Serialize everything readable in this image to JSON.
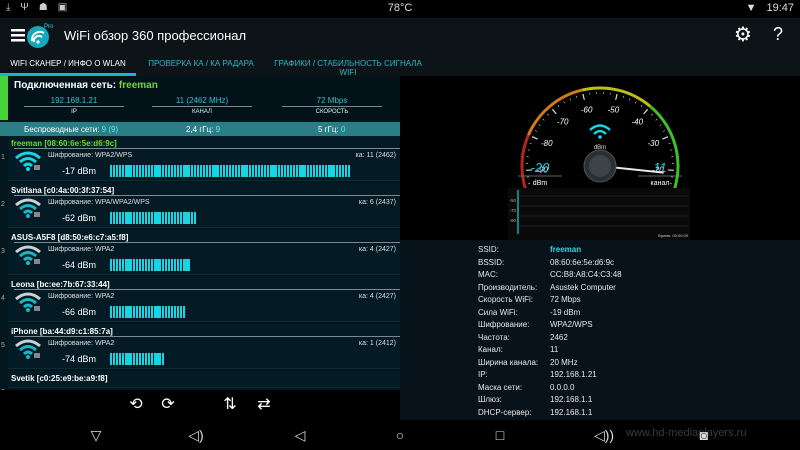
{
  "status_bar": {
    "left_icons": [
      "download-icon",
      "usb-icon",
      "android-icon",
      "image-icon"
    ],
    "temperature": "78°C",
    "time": "19:47"
  },
  "app_bar": {
    "logo_badge": "Pro",
    "title": "WiFi обзор 360 профессионал",
    "settings_icon": "gear-icon",
    "help_label": "?"
  },
  "tabs": [
    {
      "label": "WIFI СКАНЕР / ИНФО О WLAN",
      "active": true
    },
    {
      "label": "ПРОВЕРКА КА / КА РАДАРА",
      "active": false
    },
    {
      "label": "ГРАФИКИ / СТАБИЛЬНОСТЬ СИГНАЛА WIFI",
      "active": false
    }
  ],
  "connected": {
    "title": "Подключенная сеть:",
    "name": "freeman",
    "ip": {
      "value": "192.168.1.21",
      "label": "IP"
    },
    "channel": {
      "value": "11 (2462 MHz)",
      "label": "КАНАЛ"
    },
    "speed": {
      "value": "72 Mbps",
      "label": "СКОРОСТЬ"
    }
  },
  "summary": {
    "wireless_label": "Беспроводные сети:",
    "wireless_value": "9 (9)",
    "band24_label": "2,4 гГц:",
    "band24_value": "9",
    "band5_label": "5 гГц:",
    "band5_value": "0"
  },
  "networks": [
    {
      "num": "1",
      "ssid": "freeman [08:60:6e:5e:d6:9c]",
      "encryption": "Шифрование: WPA2/WPS",
      "channel": "ка: 11 (2462)",
      "dbm": "-17 dBm",
      "level": 0.83,
      "connected": true
    },
    {
      "num": "2",
      "ssid": "Svitlana [c0:4a:00:3f:37:54]",
      "encryption": "Шифрование: WPA/WPA2/WPS",
      "channel": "ка: 6 (2437)",
      "dbm": "-62 dBm",
      "level": 0.3,
      "connected": false
    },
    {
      "num": "3",
      "ssid": "ASUS-A5F8 [d8:50:e6:c7:a5:f8]",
      "encryption": "Шифрование: WPA2",
      "channel": "ка: 4 (2427)",
      "dbm": "-64 dBm",
      "level": 0.28,
      "connected": false
    },
    {
      "num": "4",
      "ssid": "Leona [bc:ee:7b:67:33:44]",
      "encryption": "Шифрование: WPA2",
      "channel": "ка: 4 (2427)",
      "dbm": "-66 dBm",
      "level": 0.26,
      "connected": false
    },
    {
      "num": "5",
      "ssid": "iPhone [ba:44:d9:c1:85:7a]",
      "encryption": "Шифрование: WPA2",
      "channel": "ка: 1 (2412)",
      "dbm": "-74 dBm",
      "level": 0.19,
      "connected": false
    },
    {
      "num": "6",
      "ssid": "Svetik [c0:25:e9:be:a9:f8]",
      "encryption": "",
      "channel": "",
      "dbm": "",
      "level": 0,
      "connected": false
    }
  ],
  "toolbar": {
    "icons": [
      "refresh-pause-icon",
      "refresh-icon",
      "sort-icon",
      "swap-icon"
    ]
  },
  "gauge": {
    "ticks": [
      "-90",
      "-80",
      "-70",
      "-60",
      "-50",
      "-40",
      "-30",
      "-20"
    ],
    "unit": "dBm",
    "dbm_value": "-20",
    "dbm_label": "dBm",
    "channel_value": "11",
    "channel_label": "канал",
    "needle_dbm": -19,
    "graph_ticks": [
      "-50",
      "-70",
      "-90"
    ],
    "graph_time_label": "Время: 00:00:09"
  },
  "details": [
    {
      "key": "SSID:",
      "value": "freeman",
      "highlight": true
    },
    {
      "key": "BSSID:",
      "value": "08:60:6e:5e:d6:9c"
    },
    {
      "key": "MAC:",
      "value": "CC:B8:A8:C4:C3:48"
    },
    {
      "key": "Производитель:",
      "value": "Asustek Computer"
    },
    {
      "key": "Скорость WiFi:",
      "value": "72 Mbps"
    },
    {
      "key": "Сила WiFi:",
      "value": "-19 dBm"
    },
    {
      "key": "Шифрование:",
      "value": "WPA2/WPS"
    },
    {
      "key": "Частота:",
      "value": "2462"
    },
    {
      "key": "Канал:",
      "value": "11"
    },
    {
      "key": "Ширина канала:",
      "value": "20 MHz"
    },
    {
      "key": "IP:",
      "value": "192.168.1.21"
    },
    {
      "key": "Маска сети:",
      "value": "0.0.0.0"
    },
    {
      "key": "Шлюз:",
      "value": "192.168.1.1"
    },
    {
      "key": "DHCP-сервер:",
      "value": "192.168.1.1"
    }
  ],
  "nav": {
    "watermark": "www.hd-mediaplayers.ru"
  },
  "colors": {
    "accent": "#16d6e3",
    "connected_green": "#6bdc2f",
    "summary_bg": "#2a7e86"
  }
}
